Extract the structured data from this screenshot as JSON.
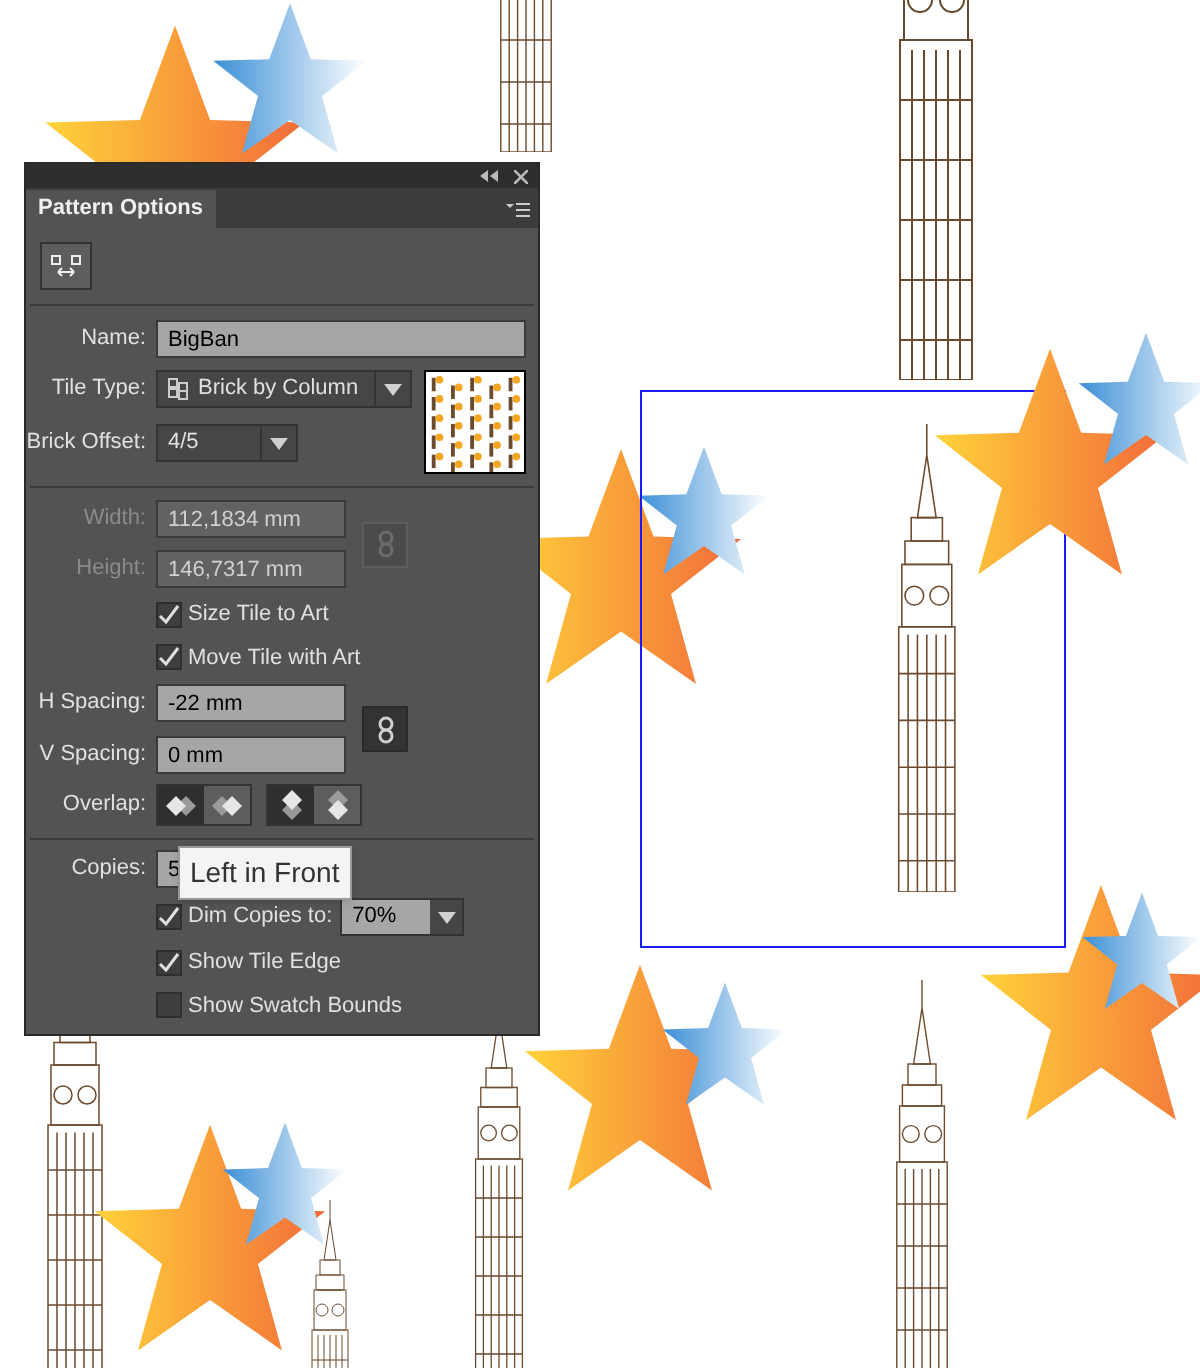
{
  "panel": {
    "title": "Pattern Options",
    "name": {
      "label": "Name:",
      "value": "BigBan"
    },
    "tile_type": {
      "label": "Tile Type:",
      "value": "Brick by Column"
    },
    "brick_offset": {
      "label": "Brick Offset:",
      "value": "4/5"
    },
    "width": {
      "label": "Width:",
      "value": "112,1834 mm",
      "disabled": true
    },
    "height": {
      "label": "Height:",
      "value": "146,7317 mm",
      "disabled": true
    },
    "size_link": {
      "disabled": true
    },
    "tile_options": [
      {
        "label": "Size Tile to Art",
        "checked": true
      },
      {
        "label": "Move Tile with Art",
        "checked": true
      }
    ],
    "h_spacing": {
      "label": "H Spacing:",
      "value": "-22 mm"
    },
    "v_spacing": {
      "label": "V Spacing:",
      "value": "0 mm"
    },
    "spacing_link": {
      "disabled": false
    },
    "overlap": {
      "label": "Overlap:",
      "buttons": [
        {
          "kind": "left",
          "selected": true
        },
        {
          "kind": "right",
          "selected": false
        },
        {
          "kind": "top",
          "selected": true
        },
        {
          "kind": "bottom",
          "selected": false
        }
      ]
    },
    "copies": {
      "label": "Copies:",
      "value": "5"
    },
    "dim_copies": {
      "label": "Dim Copies to:",
      "checked": true,
      "value": "70%"
    },
    "display_options": [
      {
        "label": "Show Tile Edge",
        "checked": true
      },
      {
        "label": "Show Swatch Bounds",
        "checked": false
      }
    ]
  },
  "tooltip": "Left in Front"
}
